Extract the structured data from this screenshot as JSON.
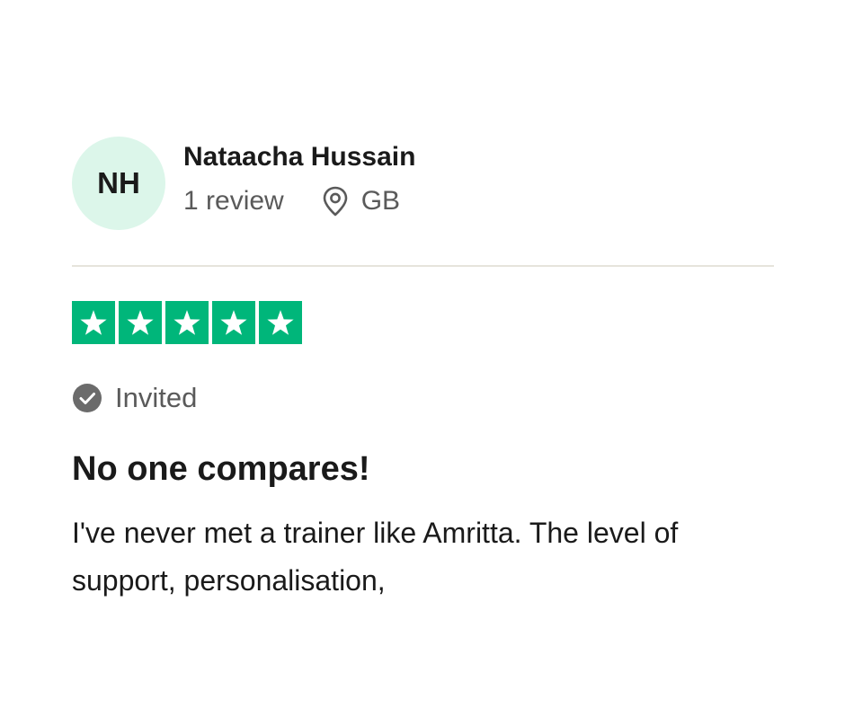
{
  "reviewer": {
    "initials": "NH",
    "name": "Nataacha Hussain",
    "review_count": "1 review",
    "country": "GB",
    "avatar_color": "#dcf6ea"
  },
  "rating": {
    "stars": 5,
    "max_stars": 5,
    "star_color": "#00b67a"
  },
  "badge": {
    "label": "Invited"
  },
  "review": {
    "title": "No one compares!",
    "text": "I've never met a trainer like Amritta. The level of support, personalisation,"
  }
}
